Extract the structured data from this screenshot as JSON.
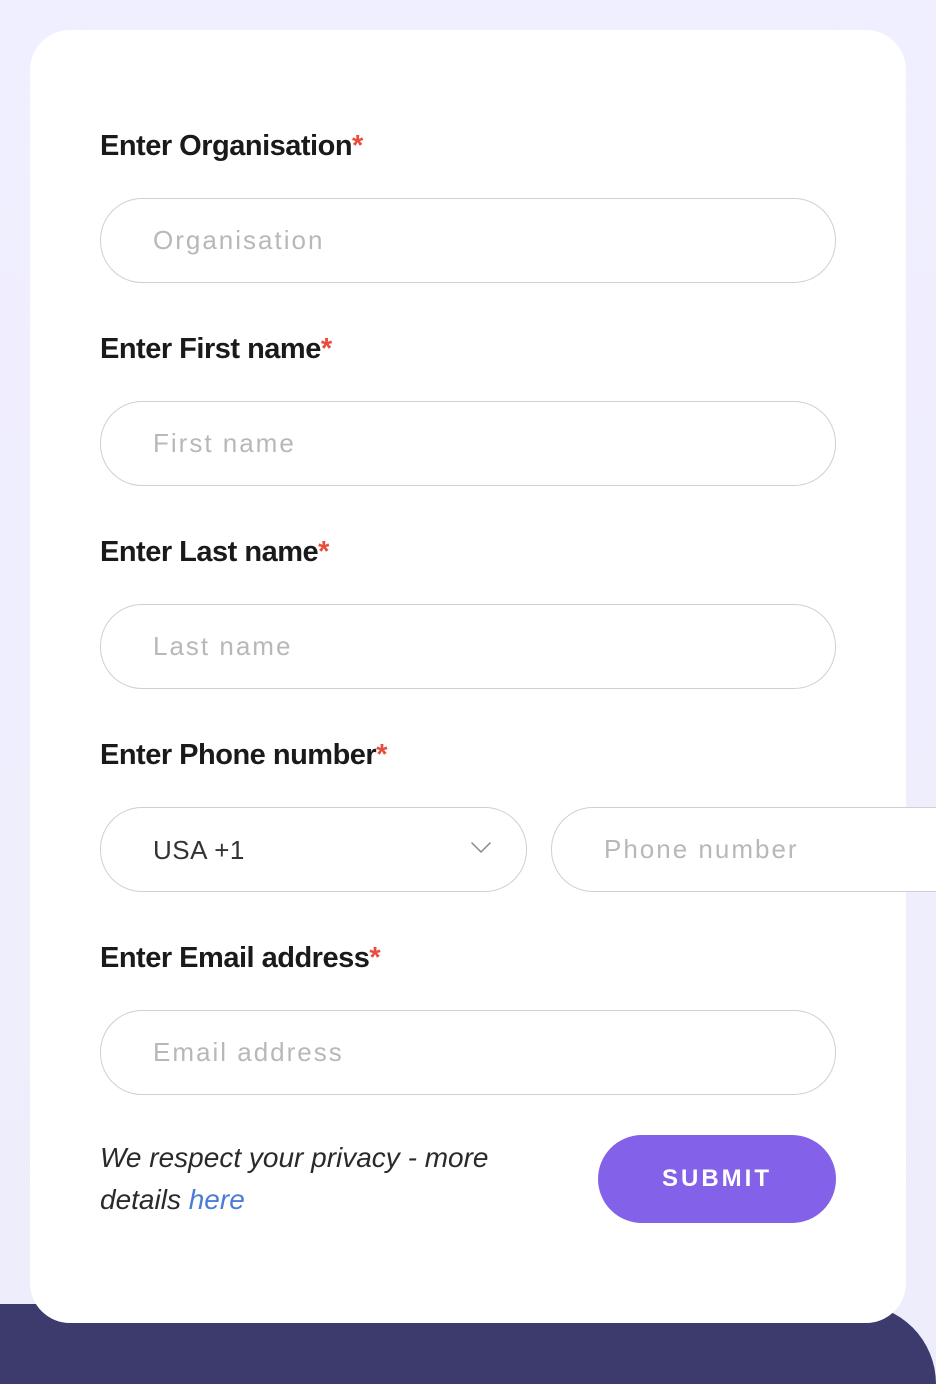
{
  "form": {
    "organisation": {
      "label": "Enter Organisation",
      "placeholder": "Organisation",
      "value": ""
    },
    "first_name": {
      "label": "Enter First name",
      "placeholder": "First name",
      "value": ""
    },
    "last_name": {
      "label": "Enter Last name",
      "placeholder": "Last name",
      "value": ""
    },
    "phone": {
      "label": "Enter Phone number",
      "country_selected": "USA +1",
      "placeholder": "Phone number",
      "value": ""
    },
    "email": {
      "label": "Enter Email address",
      "placeholder": "Email address",
      "value": ""
    }
  },
  "required_marker": "*",
  "privacy": {
    "text_part1": "We respect your privacy - more details ",
    "link_text": "here"
  },
  "submit_label": "SUBMIT"
}
